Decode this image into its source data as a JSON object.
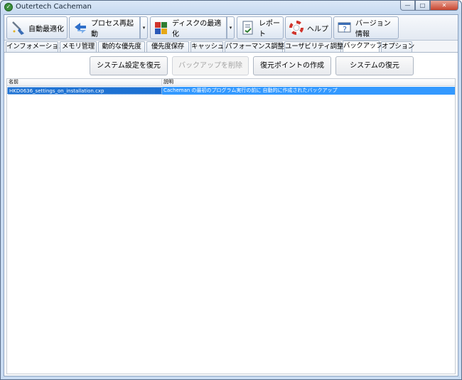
{
  "window": {
    "title": "Outertech Cacheman",
    "controls": {
      "minimize": "—",
      "maximize": "□",
      "close": "✕"
    }
  },
  "toolbar": {
    "auto_optimize": "自動最適化",
    "process_restart": "プロセス再起動",
    "disk_optimize": "ディスクの最適化",
    "report": "レポート",
    "help": "ヘルプ",
    "version_info": "バージョン情報",
    "dropdown_glyph": "▾"
  },
  "tabs": [
    {
      "label": "インフォメーション"
    },
    {
      "label": "メモリ管理"
    },
    {
      "label": "動的な優先度"
    },
    {
      "label": "優先度保存"
    },
    {
      "label": "キャッシュ"
    },
    {
      "label": "パフォーマンス調整"
    },
    {
      "label": "ユーザビリティ調整"
    },
    {
      "label": "バックアップ"
    },
    {
      "label": "オプション"
    }
  ],
  "active_tab": "バックアップ",
  "actions": {
    "restore_settings": "システム設定を復元",
    "delete_backup": "バックアップを削除",
    "create_restore_point": "復元ポイントの作成",
    "system_restore": "システムの復元"
  },
  "backup_list": {
    "columns": {
      "name": "名前",
      "description": "説明"
    },
    "rows": [
      {
        "name": "HKD0636_settings_on_installation.cxp",
        "description": "Cacheman の最初のプログラム実行の前に 自動的に作成されたバックアップ"
      }
    ]
  },
  "colors": {
    "selection": "#3399ff",
    "selection_focus": "#1e72d3",
    "frame": "#c9dcf2",
    "close_button": "#c8452f"
  }
}
